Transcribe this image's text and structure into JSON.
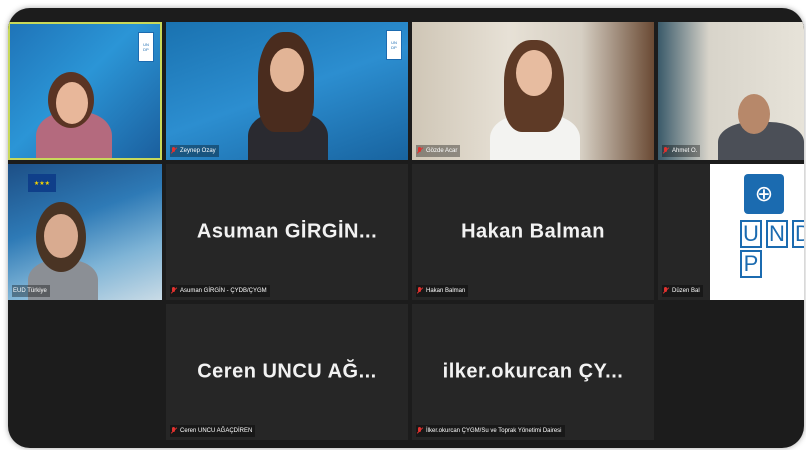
{
  "participants": [
    {
      "id": "p1",
      "label": "",
      "large_name": "",
      "muted": false,
      "active": true
    },
    {
      "id": "p2",
      "label": "Zeynep Ozay",
      "large_name": "",
      "muted": true,
      "active": false
    },
    {
      "id": "p3",
      "label": "Gözde Acar",
      "large_name": "",
      "muted": true,
      "active": false
    },
    {
      "id": "p4",
      "label": "Ahmet O.",
      "large_name": "",
      "muted": true,
      "active": false
    },
    {
      "id": "p5",
      "label": "EUD Türkiye",
      "large_name": "",
      "muted": false,
      "active": false
    },
    {
      "id": "p6",
      "label": "Asuman GİRGİN - ÇYDB/ÇYGM",
      "large_name": "Asuman  GİRGİN...",
      "muted": true,
      "active": false
    },
    {
      "id": "p7",
      "label": "Hakan Balman",
      "large_name": "Hakan Balman",
      "muted": true,
      "active": false
    },
    {
      "id": "p8",
      "label": "Düzen Bal",
      "large_name": "",
      "muted": true,
      "active": false
    },
    {
      "id": "p9",
      "label": "Ceren UNCU AĞAÇDİREN",
      "large_name": "Ceren UNCU AĞ...",
      "muted": true,
      "active": false
    },
    {
      "id": "p10",
      "label": "İlker.okurcan ÇYGM/Su ve Toprak Yönetimi Dairesi",
      "large_name": "ilker.okurcan  ÇY...",
      "muted": true,
      "active": false
    }
  ],
  "undp_logo": {
    "letters": [
      "U",
      "N",
      "D",
      "P"
    ]
  },
  "colors": {
    "active_border": "#c8d85a",
    "mic_muted": "#e0322f",
    "tile_bg": "#262626",
    "undp_blue": "#1b6bb0"
  }
}
